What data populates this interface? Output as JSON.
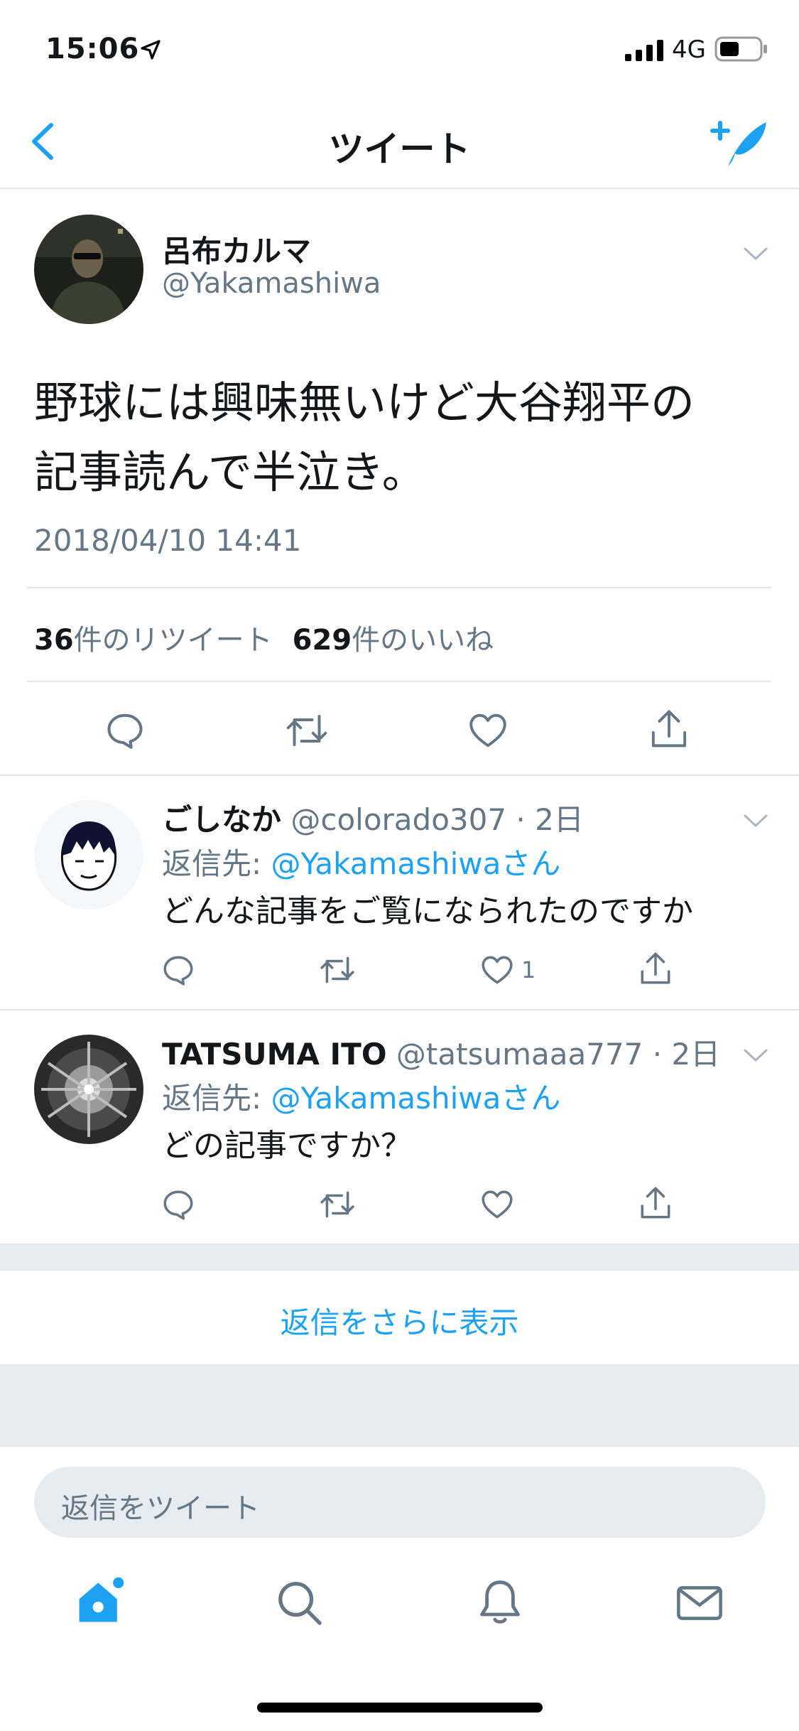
{
  "status_bar": {
    "time": "15:06",
    "network": "4G",
    "icons": [
      "location-arrow-icon",
      "signal-icon",
      "battery-icon"
    ]
  },
  "nav": {
    "title": "ツイート",
    "back_icon": "chevron-left-icon",
    "compose_icon": "compose-tweet-icon"
  },
  "tweet": {
    "author_name": "呂布カルマ",
    "handle": "@Yakamashiwa",
    "text_lines": [
      "野球には興味無いけど大谷翔平の",
      "記事読んで半泣き。"
    ],
    "timestamp": "2018/04/10 14:41",
    "retweet_count": "36",
    "retweet_label": "件のリツイート",
    "like_count": "629",
    "like_label": "件のいいね"
  },
  "replies": [
    {
      "name": "ごしなか",
      "meta": "@colorado307 · 2日",
      "reply_to_label": "返信先: ",
      "reply_to_link": "@Yakamashiwaさん",
      "text": "どんな記事をご覧になられたのですか",
      "like_count": "1"
    },
    {
      "name": "TATSUMA ITO",
      "meta": "@tatsumaaa777 · 2日",
      "reply_to_label": "返信先: ",
      "reply_to_link": "@Yakamashiwaさん",
      "text": "どの記事ですか？",
      "like_count": ""
    }
  ],
  "more_replies_label": "返信をさらに表示",
  "composer": {
    "placeholder": "返信をツイート"
  },
  "tab_bar": {
    "tabs": [
      "home-icon",
      "search-icon",
      "notifications-icon",
      "messages-icon"
    ],
    "active": "home-icon"
  },
  "colors": {
    "accent": "#1da1f2",
    "secondary_text": "#657786",
    "divider": "#e1e8ed",
    "background_gray": "#e6ecf0"
  }
}
